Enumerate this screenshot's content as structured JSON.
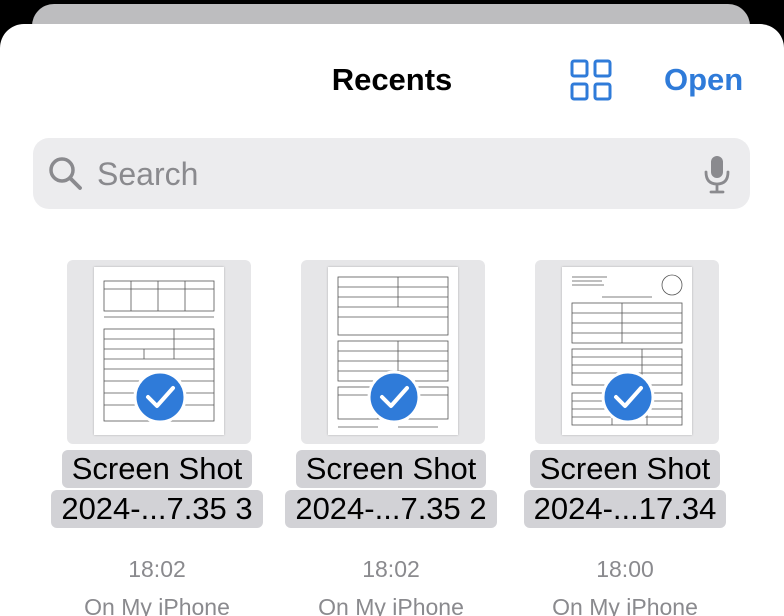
{
  "header": {
    "title": "Recents",
    "open_label": "Open"
  },
  "search": {
    "placeholder": "Search",
    "value": ""
  },
  "icons": {
    "view_toggle": "grid-view-icon",
    "search": "search-icon",
    "dictation": "microphone-icon",
    "selected": "checkmark-circle-icon"
  },
  "colors": {
    "accent": "#2f7bd9",
    "secondary_text": "#8a8a8e",
    "search_background": "#ececee",
    "selection_highlight": "#d2d2d6"
  },
  "files": [
    {
      "name_line1": "Screen Shot",
      "name_line2": "2024-...7.35 3",
      "time": "18:02",
      "location": "On My iPhone",
      "selected": true
    },
    {
      "name_line1": "Screen Shot",
      "name_line2": "2024-...7.35 2",
      "time": "18:02",
      "location": "On My iPhone",
      "selected": true
    },
    {
      "name_line1": "Screen Shot",
      "name_line2": "2024-...17.34",
      "time": "18:00",
      "location": "On My iPhone",
      "selected": true
    }
  ]
}
